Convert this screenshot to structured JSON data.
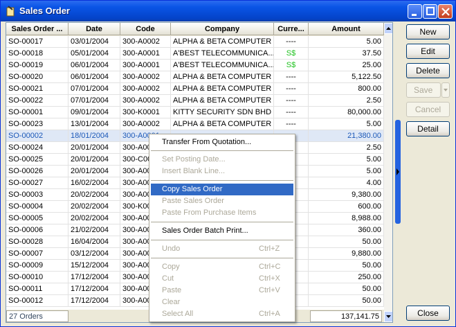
{
  "window": {
    "title": "Sales Order"
  },
  "columns": [
    "Sales Order ...",
    "Date",
    "Code",
    "Company",
    "Curre...",
    "Amount"
  ],
  "rows": [
    {
      "no": "SO-00017",
      "date": "03/01/2004",
      "code": "300-A0002",
      "company": "ALPHA & BETA COMPUTER",
      "curr": "----",
      "amount": "5.00"
    },
    {
      "no": "SO-00018",
      "date": "05/01/2004",
      "code": "300-A0001",
      "company": "A'BEST TELECOMMUNICA...",
      "curr": "S$",
      "amount": "37.50"
    },
    {
      "no": "SO-00019",
      "date": "06/01/2004",
      "code": "300-A0001",
      "company": "A'BEST TELECOMMUNICA...",
      "curr": "S$",
      "amount": "25.00"
    },
    {
      "no": "SO-00020",
      "date": "06/01/2004",
      "code": "300-A0002",
      "company": "ALPHA & BETA COMPUTER",
      "curr": "----",
      "amount": "5,122.50"
    },
    {
      "no": "SO-00021",
      "date": "07/01/2004",
      "code": "300-A0002",
      "company": "ALPHA & BETA COMPUTER",
      "curr": "----",
      "amount": "800.00"
    },
    {
      "no": "SO-00022",
      "date": "07/01/2004",
      "code": "300-A0002",
      "company": "ALPHA & BETA COMPUTER",
      "curr": "----",
      "amount": "2.50"
    },
    {
      "no": "SO-00001",
      "date": "09/01/2004",
      "code": "300-K0001",
      "company": "KITTY SECURITY SDN BHD",
      "curr": "----",
      "amount": "80,000.00"
    },
    {
      "no": "SO-00023",
      "date": "13/01/2004",
      "code": "300-A0002",
      "company": "ALPHA & BETA COMPUTER",
      "curr": "----",
      "amount": "5.00"
    },
    {
      "no": "SO-00002",
      "date": "18/01/2004",
      "code": "300-A0001",
      "company": "",
      "curr": "",
      "amount": "21,380.00"
    },
    {
      "no": "SO-00024",
      "date": "20/01/2004",
      "code": "300-A00",
      "company": "",
      "curr": "",
      "amount": "2.50"
    },
    {
      "no": "SO-00025",
      "date": "20/01/2004",
      "code": "300-C00",
      "company": "",
      "curr": "",
      "amount": "5.00"
    },
    {
      "no": "SO-00026",
      "date": "20/01/2004",
      "code": "300-A00",
      "company": "",
      "curr": "",
      "amount": "5.00"
    },
    {
      "no": "SO-00027",
      "date": "16/02/2004",
      "code": "300-A00",
      "company": "",
      "curr": "",
      "amount": "4.00"
    },
    {
      "no": "SO-00003",
      "date": "20/02/2004",
      "code": "300-A00",
      "company": "",
      "curr": "",
      "amount": "9,380.00"
    },
    {
      "no": "SO-00004",
      "date": "20/02/2004",
      "code": "300-K00",
      "company": "",
      "curr": "",
      "amount": "600.00"
    },
    {
      "no": "SO-00005",
      "date": "20/02/2004",
      "code": "300-A00",
      "company": "",
      "curr": "",
      "amount": "8,988.00"
    },
    {
      "no": "SO-00006",
      "date": "21/02/2004",
      "code": "300-A00",
      "company": "",
      "curr": "",
      "amount": "360.00"
    },
    {
      "no": "SO-00028",
      "date": "16/04/2004",
      "code": "300-A00",
      "company": "",
      "curr": "",
      "amount": "50.00"
    },
    {
      "no": "SO-00007",
      "date": "03/12/2004",
      "code": "300-A00",
      "company": "",
      "curr": "",
      "amount": "9,880.00"
    },
    {
      "no": "SO-00009",
      "date": "15/12/2004",
      "code": "300-A00",
      "company": "",
      "curr": "",
      "amount": "50.00"
    },
    {
      "no": "SO-00010",
      "date": "17/12/2004",
      "code": "300-A00",
      "company": "",
      "curr": "",
      "amount": "250.00"
    },
    {
      "no": "SO-00011",
      "date": "17/12/2004",
      "code": "300-A00",
      "company": "",
      "curr": "",
      "amount": "50.00"
    },
    {
      "no": "SO-00012",
      "date": "17/12/2004",
      "code": "300-A00",
      "company": "",
      "curr": "",
      "amount": "50.00"
    }
  ],
  "footer": {
    "count": "27 Orders",
    "total": "137,141.75"
  },
  "buttons": {
    "new": "New",
    "edit": "Edit",
    "delete": "Delete",
    "save": "Save",
    "cancel": "Cancel",
    "detail": "Detail",
    "close": "Close"
  },
  "menu": {
    "transfer": "Transfer From Quotation...",
    "set_posting": "Set Posting Date...",
    "insert_blank": "Insert Blank Line...",
    "copy_so": "Copy Sales Order",
    "paste_so": "Paste Sales Order",
    "paste_pi": "Paste From Purchase Items",
    "batch_print": "Sales Order Batch Print...",
    "undo": "Undo",
    "undo_sc": "Ctrl+Z",
    "copy": "Copy",
    "copy_sc": "Ctrl+C",
    "cut": "Cut",
    "cut_sc": "Ctrl+X",
    "paste": "Paste",
    "paste_sc": "Ctrl+V",
    "clear": "Clear",
    "select_all": "Select All",
    "select_all_sc": "Ctrl+A"
  },
  "colors": {
    "selection": "#316ac5",
    "currency_green": "#1fc21f",
    "titlebar": "#0a55e6"
  }
}
